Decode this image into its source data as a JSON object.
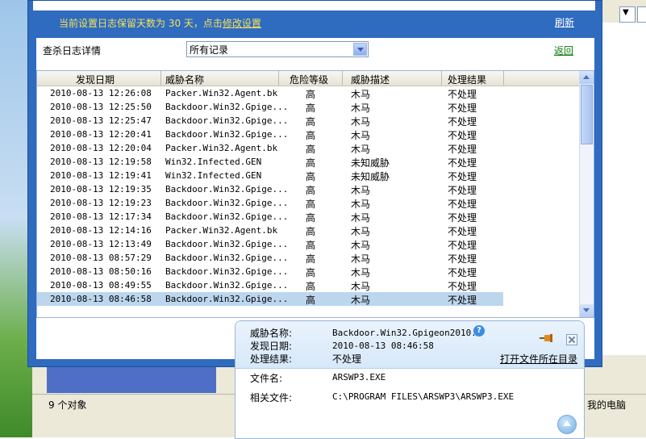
{
  "retention_text": "当前设置日志保留天数为 30 天，点击",
  "modify_link": "修改设置",
  "refresh_label": "刷新",
  "panel_label": "查杀日志详情",
  "filter_value": "所有记录",
  "back_label": "返回",
  "columns": [
    "发现日期",
    "威胁名称",
    "危险等级",
    "威胁描述",
    "处理结果"
  ],
  "rows": [
    [
      "2010-08-13 12:26:08",
      "Packer.Win32.Agent.bk",
      "高",
      "木马",
      "不处理"
    ],
    [
      "2010-08-13 12:25:50",
      "Backdoor.Win32.Gpige...",
      "高",
      "木马",
      "不处理"
    ],
    [
      "2010-08-13 12:25:47",
      "Backdoor.Win32.Gpige...",
      "高",
      "木马",
      "不处理"
    ],
    [
      "2010-08-13 12:20:41",
      "Backdoor.Win32.Gpige...",
      "高",
      "木马",
      "不处理"
    ],
    [
      "2010-08-13 12:20:04",
      "Packer.Win32.Agent.bk",
      "高",
      "木马",
      "不处理"
    ],
    [
      "2010-08-13 12:19:58",
      "Win32.Infected.GEN",
      "高",
      "未知威胁",
      "不处理"
    ],
    [
      "2010-08-13 12:19:41",
      "Win32.Infected.GEN",
      "高",
      "未知威胁",
      "不处理"
    ],
    [
      "2010-08-13 12:19:35",
      "Backdoor.Win32.Gpige...",
      "高",
      "木马",
      "不处理"
    ],
    [
      "2010-08-13 12:19:23",
      "Backdoor.Win32.Gpige...",
      "高",
      "木马",
      "不处理"
    ],
    [
      "2010-08-13 12:17:34",
      "Backdoor.Win32.Gpige...",
      "高",
      "木马",
      "不处理"
    ],
    [
      "2010-08-13 12:14:16",
      "Packer.Win32.Agent.bk",
      "高",
      "木马",
      "不处理"
    ],
    [
      "2010-08-13 12:13:49",
      "Backdoor.Win32.Gpige...",
      "高",
      "木马",
      "不处理"
    ],
    [
      "2010-08-13 08:57:29",
      "Backdoor.Win32.Gpige...",
      "高",
      "木马",
      "不处理"
    ],
    [
      "2010-08-13 08:50:16",
      "Backdoor.Win32.Gpige...",
      "高",
      "木马",
      "不处理"
    ],
    [
      "2010-08-13 08:49:55",
      "Backdoor.Win32.Gpige...",
      "高",
      "木马",
      "不处理"
    ],
    [
      "2010-08-13 08:46:58",
      "Backdoor.Win32.Gpige...",
      "高",
      "木马",
      "不处理"
    ]
  ],
  "selected_row": 15,
  "detail": {
    "threat_name_label": "威胁名称:",
    "threat_name": "Backdoor.Win32.Gpigeon2010.a",
    "found_date_label": "发现日期:",
    "found_date": "2010-08-13 08:46:58",
    "result_label": "处理结果:",
    "result": "不处理",
    "open_dir": "打开文件所在目录",
    "filename_label": "文件名:",
    "filename": "ARSWP3.EXE",
    "related_label": "相关文件:",
    "related": "C:\\PROGRAM FILES\\ARSWP3\\ARSWP3.EXE"
  },
  "status_count": "9 个对象",
  "status_location": "我的电脑"
}
